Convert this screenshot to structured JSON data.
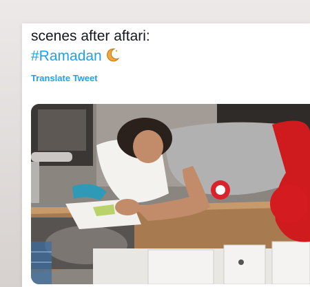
{
  "tweet": {
    "text_line1": "scenes after aftari:",
    "hashtag": "#Ramadan",
    "emoji_icon": "crescent-moon-icon",
    "translate_label": "Translate Tweet"
  },
  "media": {
    "description_icon": "photo",
    "colors": {
      "link": "#1da1f2",
      "text": "#14171a"
    }
  }
}
